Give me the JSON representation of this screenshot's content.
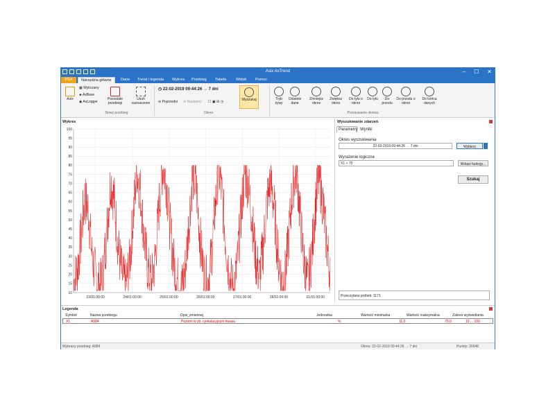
{
  "window": {
    "title": "Asix AsTrend"
  },
  "tabs": [
    "PSA",
    "Narzędzia główne",
    "Dane",
    "Trend i legenda",
    "Wykres",
    "Przebieg",
    "Tabela",
    "Widok",
    "Pomoc"
  ],
  "ribbon": {
    "asix": "Asix",
    "wyliczany": "Wyliczany",
    "asbase": "AsBase",
    "aslogger": "AsLogger",
    "pozostale": "Pozostałe przebiegi",
    "usun": "Usuń zaznaczone",
    "group_nowy": "Nowy przebieg",
    "period_value": "22-02-2019 09:44:26 → 7 dni",
    "poprzedni": "Poprzedni",
    "nastepny": "Następny",
    "wyszukaj": "Wyszukaj",
    "group_okres": "Okres",
    "tryb": "Tryb żywy",
    "ostatnie": "Ostatnie dane",
    "zmniejsz": "Zmniejsz okres",
    "zwieksz": "Zwiększ okres",
    "dotylu_okres": "Do tyłu o okres",
    "dotylu": "Do tyłu",
    "doprzodu": "Do przodu",
    "doprzodu_okres": "Do przodu o okres",
    "dokonca": "Do końca danych",
    "group_przesuwanie": "Przesuwanie okresu"
  },
  "chart": {
    "title": "Wykres",
    "y_ticks": [
      "100",
      "95",
      "90",
      "85",
      "80",
      "75",
      "70",
      "65",
      "60",
      "55",
      "50",
      "45",
      "40",
      "35",
      "30",
      "25",
      "20",
      "15",
      "10"
    ],
    "x_ticks": [
      "23/01:00:00",
      "24/01:00:00",
      "25/01:00:00",
      "26/01:00:00",
      "27/01:00:00",
      "28/01:00:00",
      "01/01:00:00"
    ],
    "line_color": "#e00000"
  },
  "chart_data": {
    "type": "line",
    "title": "",
    "ylim": [
      10,
      100
    ],
    "x_ticks": [
      "23/01:00:00",
      "24/01:00:00",
      "25/01:00:00",
      "26/01:00:00",
      "27/01:00:00",
      "28/01:00:00",
      "01/01:00:00"
    ],
    "series": [
      {
        "values": [
          15,
          22,
          40,
          62,
          55,
          30,
          18,
          12,
          20,
          45,
          72,
          60,
          35,
          20,
          14,
          25,
          50,
          78,
          65,
          40,
          22,
          15,
          30,
          58,
          80,
          70,
          45,
          25,
          16,
          12,
          22,
          48,
          75,
          68,
          40,
          20,
          14,
          28,
          55,
          79,
          62,
          35,
          18,
          12,
          25,
          52,
          76,
          70,
          50,
          28,
          18,
          35,
          60,
          72,
          55,
          30,
          16,
          20,
          45,
          70,
          78,
          50,
          25,
          14,
          30,
          58,
          74,
          60,
          38,
          20
        ]
      }
    ]
  },
  "search": {
    "title": "Wyszukiwanie zdarzeń",
    "tab_param": "Parametry",
    "tab_results": "Wyniki",
    "okres_label": "Okres wyszukiwania",
    "okres_value": "22-02-2019 09:44:26 → 7 dni",
    "wybierz": "Wybierz",
    "wyrazenie_label": "Wyrażenie logiczne",
    "wyrazenie_value": "X1 > 70",
    "wstaw": "Wstaw funkcję...",
    "szukaj": "Szukaj",
    "przeczytano": "Przeczytano próbek: 1171"
  },
  "legend": {
    "title": "Legenda",
    "headers": [
      "Symbol",
      "Nazwa przebiegu",
      "Opis_zmiennej",
      "Jednostka",
      "Wartość minimalna",
      "Wartość maksymalna",
      "Zakres wyświetlania"
    ],
    "row": {
      "symbol": "X1",
      "name": "A084",
      "desc": "Poziom w zb. cyrkulacyjnym kwasu",
      "unit": "%",
      "min": "11,0",
      "max": "79,0",
      "range": "10 ... 100"
    }
  },
  "status": {
    "left": "Wybrany przebieg: A084",
    "mid": "Okres: 22-02-2019 09:44:26 → 7 dni",
    "right": "Punkty: 20048"
  }
}
